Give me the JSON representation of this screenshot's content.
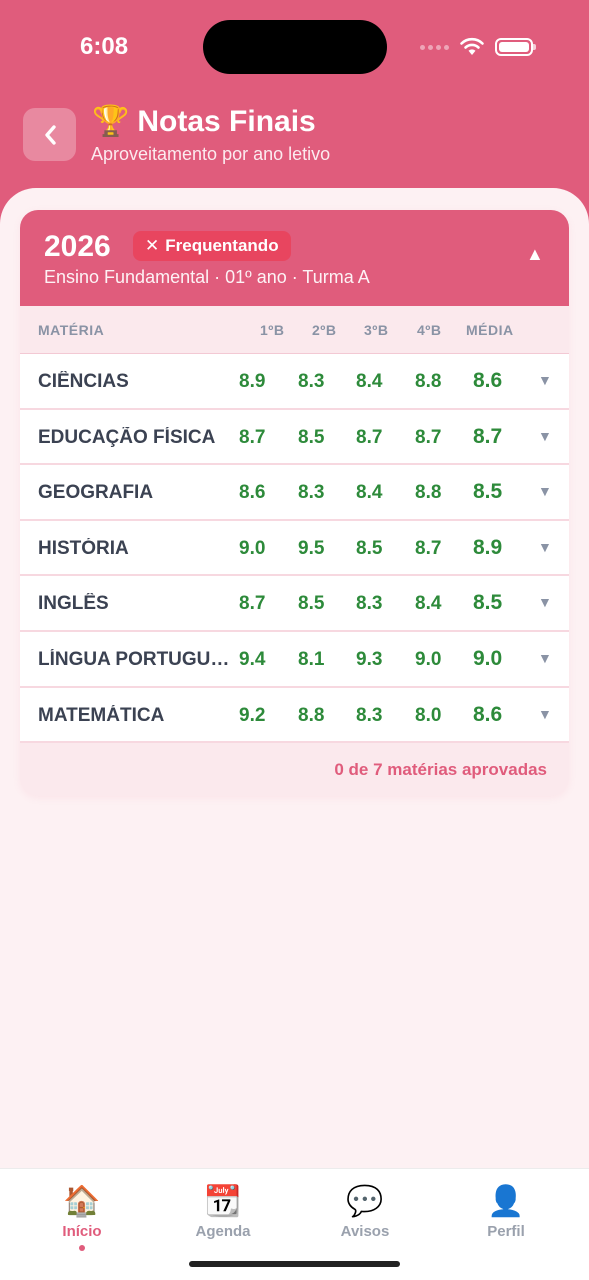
{
  "status_bar": {
    "time": "6:08"
  },
  "header": {
    "back_icon": "chevron-left-icon",
    "trophy_icon": "🏆",
    "title": "Notas Finais",
    "subtitle": "Aproveitamento por ano letivo"
  },
  "year_card": {
    "year": "2026",
    "badge": {
      "icon": "✕",
      "label": "Frequentando"
    },
    "subtitle": "Ensino Fundamental · 01º ano · Turma A",
    "columns": {
      "subject": "MATÉRIA",
      "b1": "1ºB",
      "b2": "2ºB",
      "b3": "3ºB",
      "b4": "4ºB",
      "avg": "MÉDIA"
    },
    "subjects": [
      {
        "name": "CIÊNCIAS",
        "b1": "8.9",
        "b2": "8.3",
        "b3": "8.4",
        "b4": "8.8",
        "avg": "8.6"
      },
      {
        "name": "EDUCAÇÃO FÍSICA",
        "b1": "8.7",
        "b2": "8.5",
        "b3": "8.7",
        "b4": "8.7",
        "avg": "8.7"
      },
      {
        "name": "GEOGRAFIA",
        "b1": "8.6",
        "b2": "8.3",
        "b3": "8.4",
        "b4": "8.8",
        "avg": "8.5"
      },
      {
        "name": "HISTÓRIA",
        "b1": "9.0",
        "b2": "9.5",
        "b3": "8.5",
        "b4": "8.7",
        "avg": "8.9"
      },
      {
        "name": "INGLÊS",
        "b1": "8.7",
        "b2": "8.5",
        "b3": "8.3",
        "b4": "8.4",
        "avg": "8.5"
      },
      {
        "name": "LÍNGUA PORTUGUESA",
        "b1": "9.4",
        "b2": "8.1",
        "b3": "9.3",
        "b4": "9.0",
        "avg": "9.0"
      },
      {
        "name": "MATEMÁTICA",
        "b1": "9.2",
        "b2": "8.8",
        "b3": "8.3",
        "b4": "8.0",
        "avg": "8.6"
      }
    ],
    "footer": "0 de 7 matérias aprovadas"
  },
  "colors": {
    "accent": "#e05c7c",
    "grade_green": "#2d8a3a",
    "badge_red": "#e8455f"
  },
  "tabbar": {
    "items": [
      {
        "label": "Início",
        "icon": "🏠",
        "active": true
      },
      {
        "label": "Agenda",
        "icon": "📆",
        "active": false
      },
      {
        "label": "Avisos",
        "icon": "💬",
        "active": false
      },
      {
        "label": "Perfil",
        "icon": "👤",
        "active": false
      }
    ]
  }
}
